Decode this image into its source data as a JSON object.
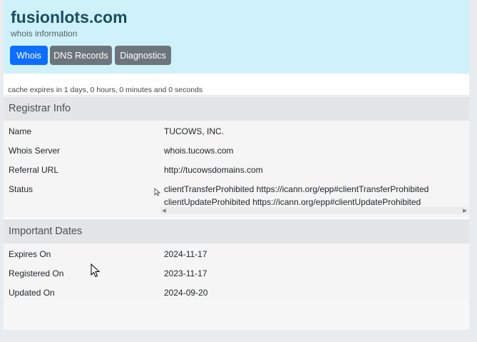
{
  "header": {
    "title": "fusionlots.com",
    "subtitle": "whois information",
    "tabs": [
      {
        "label": "Whois"
      },
      {
        "label": "DNS Records"
      },
      {
        "label": "Diagnostics"
      }
    ]
  },
  "cache_text": "cache expires in 1 days, 0 hours, 0 minutes and 0 seconds",
  "registrar": {
    "heading": "Registrar Info",
    "rows": [
      {
        "label": "Name",
        "value": "TUCOWS, INC."
      },
      {
        "label": "Whois Server",
        "value": "whois.tucows.com"
      },
      {
        "label": "Referral URL",
        "value": "http://tucowsdomains.com"
      },
      {
        "label": "Status",
        "values": [
          "clientTransferProhibited https://icann.org/epp#clientTransferProhibited",
          "clientUpdateProhibited https://icann.org/epp#clientUpdateProhibited"
        ]
      }
    ]
  },
  "dates": {
    "heading": "Important Dates",
    "rows": [
      {
        "label": "Expires On",
        "value": "2024-11-17"
      },
      {
        "label": "Registered On",
        "value": "2023-11-17"
      },
      {
        "label": "Updated On",
        "value": "2024-09-20"
      }
    ]
  },
  "colors": {
    "header_bg": "#cff1f9",
    "primary": "#0d6efd",
    "secondary": "#6c757d"
  },
  "icons": {
    "scroll_left": "scroll-left-arrow-icon",
    "scroll_right": "scroll-right-arrow-icon",
    "cursor": "mouse-pointer-icon"
  }
}
